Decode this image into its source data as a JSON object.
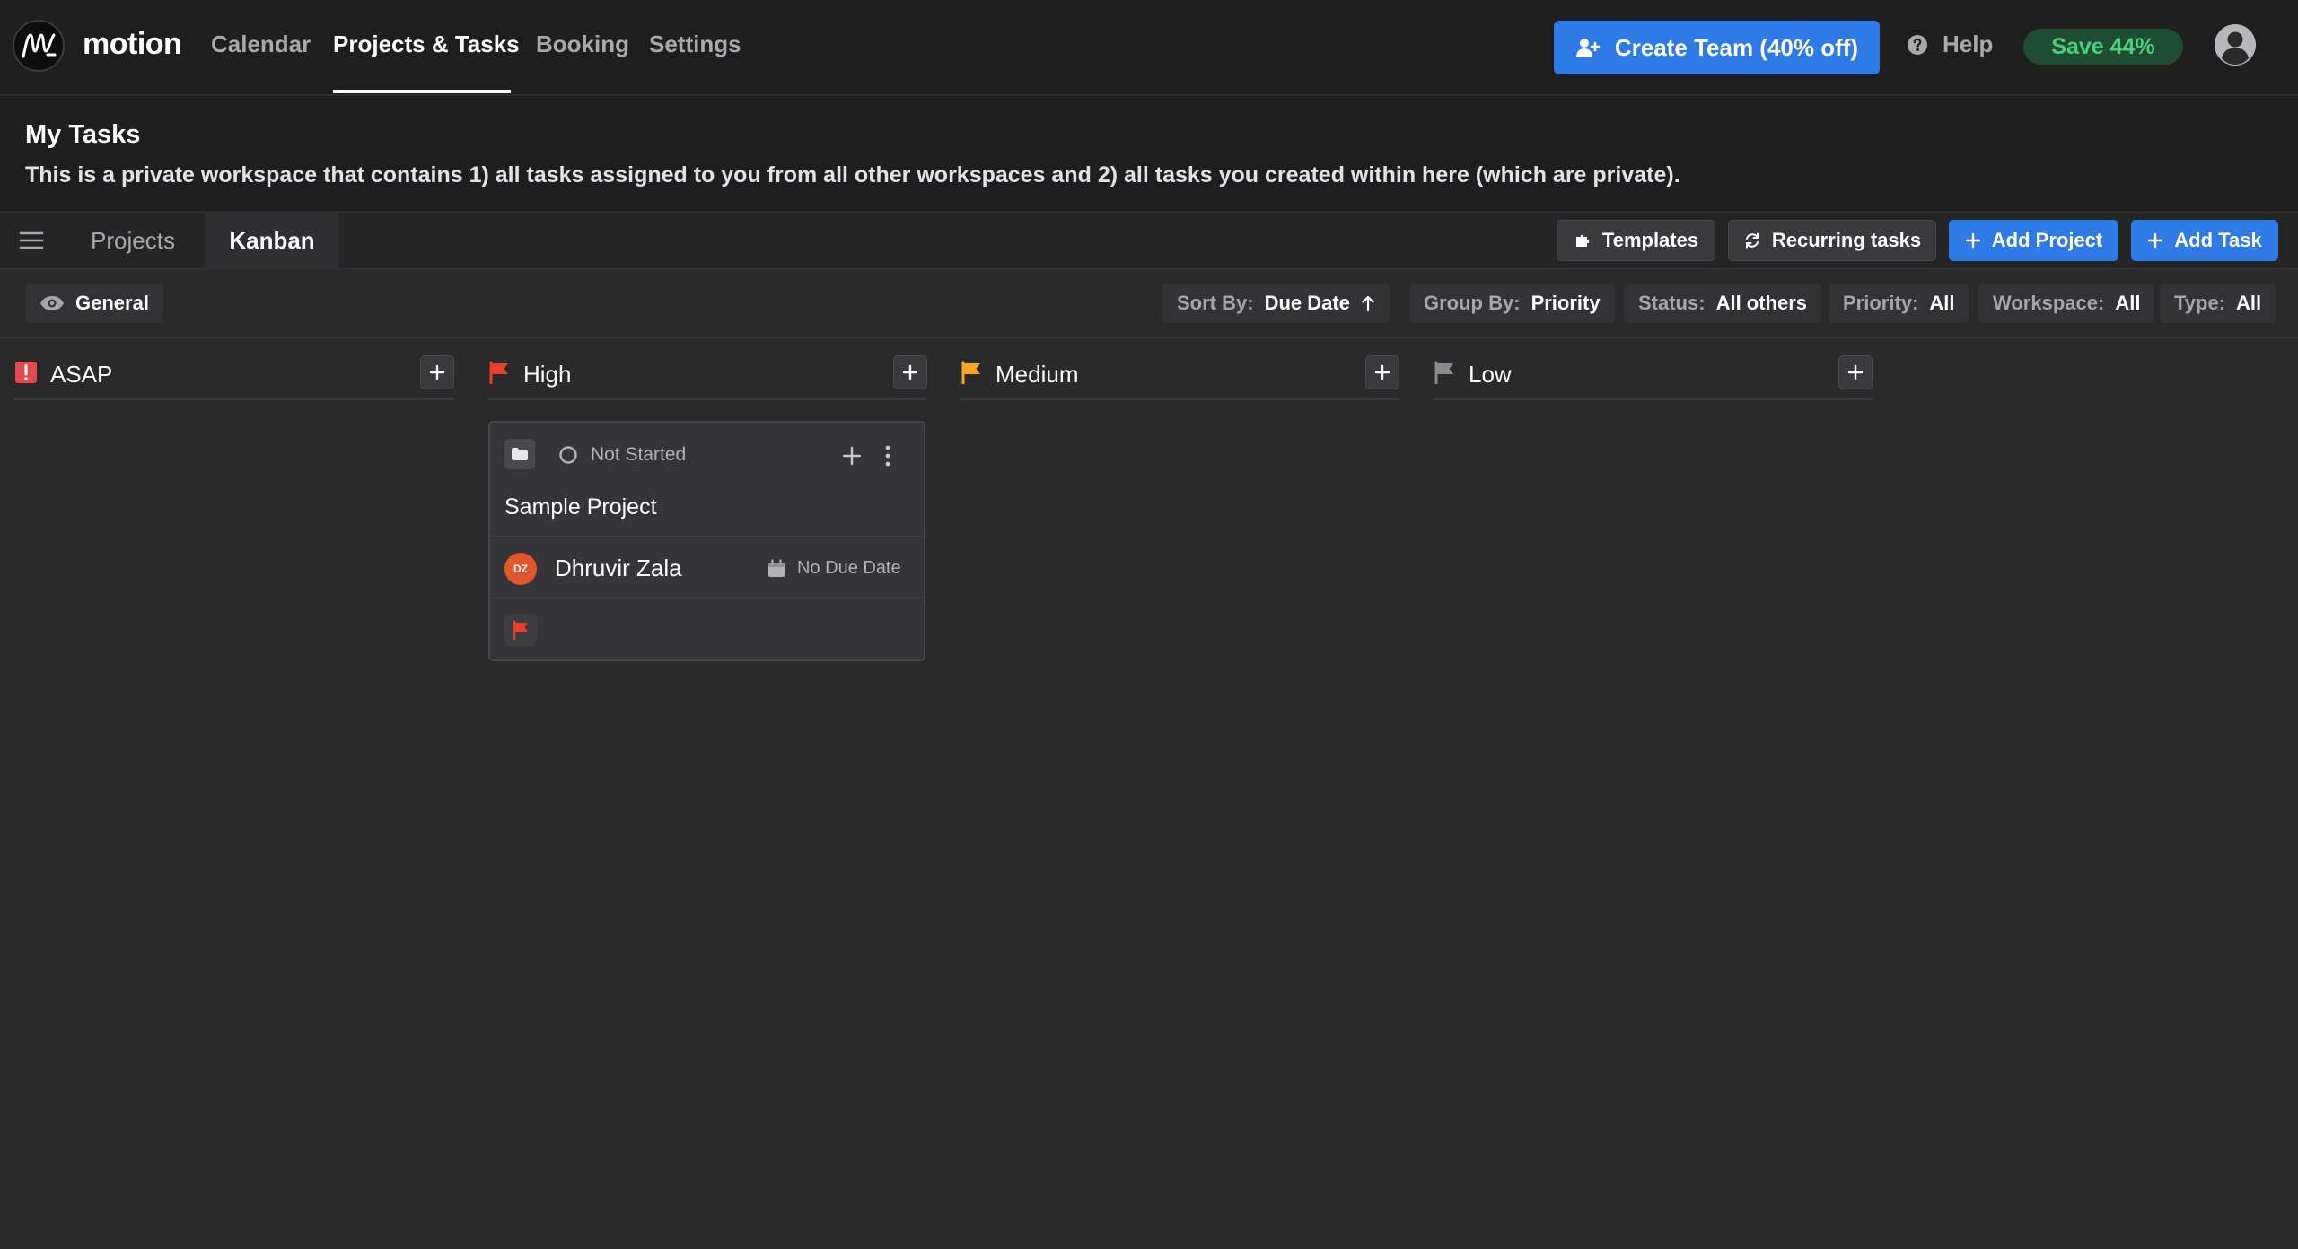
{
  "brand": {
    "name": "motion"
  },
  "nav": {
    "items": [
      {
        "label": "Calendar"
      },
      {
        "label": "Projects & Tasks"
      },
      {
        "label": "Booking"
      },
      {
        "label": "Settings"
      }
    ],
    "active": "Projects & Tasks"
  },
  "header_actions": {
    "create_team": "Create Team (40% off)",
    "help": "Help",
    "save_badge": "Save 44%"
  },
  "page": {
    "title": "My Tasks",
    "description": "This is a private workspace that contains 1) all tasks assigned to you from all other workspaces and 2) all tasks you created within here (which are private)."
  },
  "tabs": [
    {
      "label": "Projects"
    },
    {
      "label": "Kanban"
    }
  ],
  "active_tab": "Kanban",
  "toolbar": {
    "templates": "Templates",
    "recurring": "Recurring tasks",
    "add_project": "Add Project",
    "add_task": "Add Task"
  },
  "view": {
    "label": "General"
  },
  "filters": {
    "sort": {
      "label": "Sort By:",
      "value": "Due Date"
    },
    "group": {
      "label": "Group By:",
      "value": "Priority"
    },
    "status": {
      "label": "Status:",
      "value": "All others"
    },
    "priority": {
      "label": "Priority:",
      "value": "All"
    },
    "workspace": {
      "label": "Workspace:",
      "value": "All"
    },
    "type": {
      "label": "Type:",
      "value": "All"
    }
  },
  "columns": [
    {
      "name": "ASAP",
      "color": "#e5484d"
    },
    {
      "name": "High",
      "color": "#e5402d"
    },
    {
      "name": "Medium",
      "color": "#f5a623"
    },
    {
      "name": "Low",
      "color": "#8a8a8e"
    }
  ],
  "card": {
    "status": "Not Started",
    "title": "Sample Project",
    "assignee": "Dhruvir Zala",
    "assignee_initials": "DZ",
    "due": "No Due Date",
    "priority_color": "#e5402d"
  },
  "colors": {
    "accent": "#2e7ae6",
    "save_green": "#4ad07b",
    "background": "#2a2a2b"
  }
}
